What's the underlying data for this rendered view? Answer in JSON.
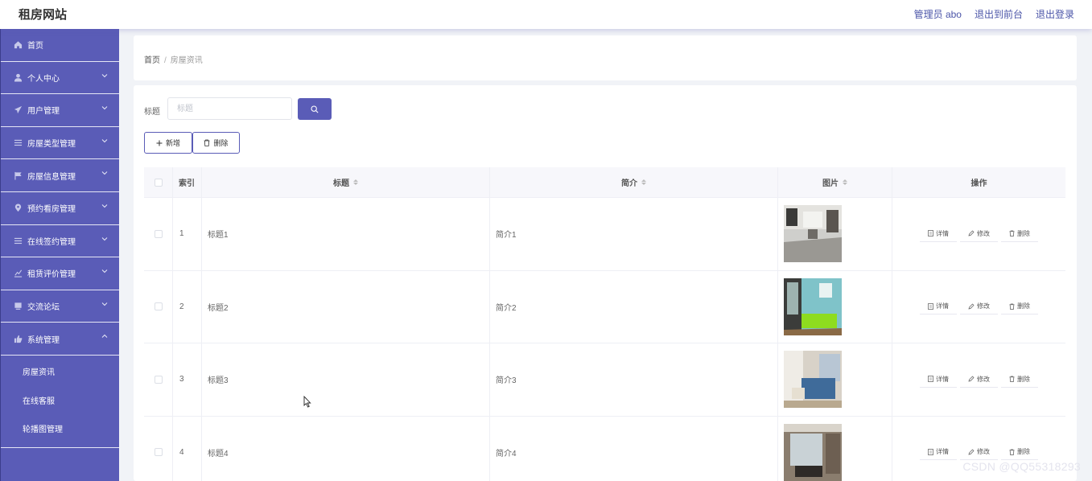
{
  "app": {
    "brand": "租房网站"
  },
  "topnav": {
    "admin": "管理员 abo",
    "to_front": "退出到前台",
    "logout": "退出登录"
  },
  "sidebar": {
    "items": [
      {
        "label": "首页",
        "icon": "home-icon"
      },
      {
        "label": "个人中心",
        "icon": "user-icon"
      },
      {
        "label": "用户管理",
        "icon": "send-icon"
      },
      {
        "label": "房屋类型管理",
        "icon": "list-icon"
      },
      {
        "label": "房屋信息管理",
        "icon": "flag-icon"
      },
      {
        "label": "预约看房管理",
        "icon": "location-icon"
      },
      {
        "label": "在线签约管理",
        "icon": "list-icon"
      },
      {
        "label": "租赁评价管理",
        "icon": "chart-icon"
      },
      {
        "label": "交流论坛",
        "icon": "monitor-icon"
      },
      {
        "label": "系统管理",
        "icon": "thumb-icon"
      }
    ],
    "submenu": [
      "房屋资讯",
      "在线客服",
      "轮播图管理"
    ]
  },
  "breadcrumb": {
    "home": "首页",
    "sep": "/",
    "current": "房屋资讯"
  },
  "search": {
    "label": "标题",
    "placeholder": "标题"
  },
  "actions": {
    "add": "新增",
    "delete": "删除"
  },
  "table": {
    "headers": {
      "index": "索引",
      "title": "标题",
      "intro": "简介",
      "picture": "图片",
      "ops": "操作"
    },
    "rows": [
      {
        "index": "1",
        "title": "标题1",
        "intro": "简介1"
      },
      {
        "index": "2",
        "title": "标题2",
        "intro": "简介2"
      },
      {
        "index": "3",
        "title": "标题3",
        "intro": "简介3"
      },
      {
        "index": "4",
        "title": "标题4",
        "intro": "简介4"
      }
    ],
    "ops": {
      "detail": "详情",
      "edit": "修改",
      "delete": "删除"
    }
  },
  "watermark": "CSDN @QQ55318293",
  "colors": {
    "accent": "#5a5cb7",
    "sidebar": "#5a5cb7",
    "background": "#f1f3f7"
  }
}
